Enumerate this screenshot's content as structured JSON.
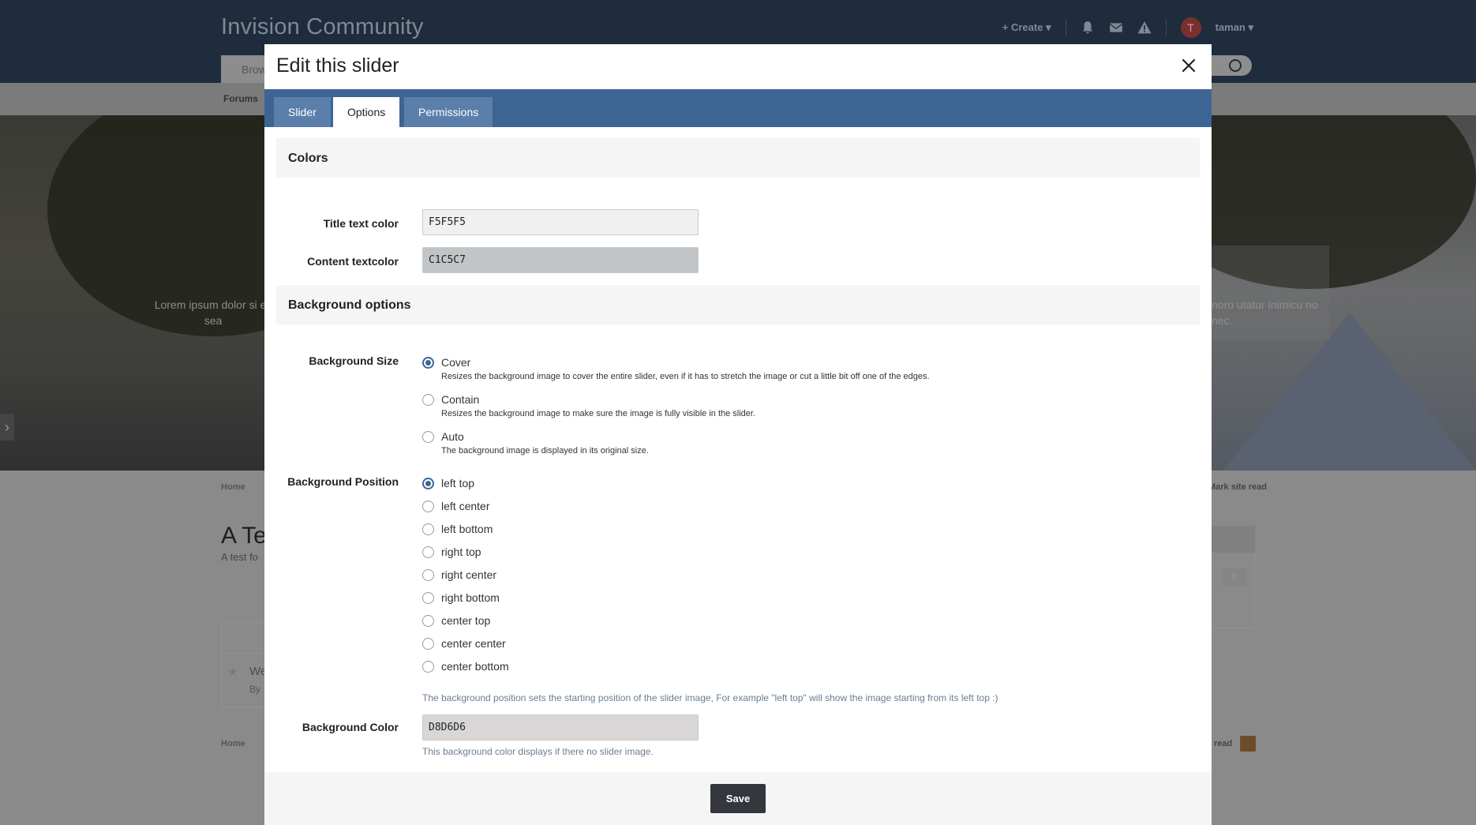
{
  "background": {
    "site_title": "Invision Community",
    "create_label": "+ Create ▾",
    "username": "taman ▾",
    "avatar_letter": "T",
    "nav_tab": "Brow",
    "subnav_item": "Forums",
    "hero_text_left": "Lorem ipsum dolor si ex sea",
    "hero_text_right": "noro utatur inimicu no nec.",
    "breadcrumb": "Home",
    "breadcrumb_right": "Mark site read",
    "forum_title": "A Te",
    "forum_desc": "A test fo",
    "right_count": "0",
    "topic_title": "We",
    "topic_by": "By",
    "breadcrumb_bottom": "Home",
    "breadcrumb_bottom_right": "read"
  },
  "modal": {
    "title": "Edit this slider",
    "tabs": [
      {
        "label": "Slider",
        "active": false
      },
      {
        "label": "Options",
        "active": true
      },
      {
        "label": "Permissions",
        "active": false
      }
    ],
    "colors_section": "Colors",
    "title_text_color": {
      "label": "Title text color",
      "value": "F5F5F5",
      "swatch": "#f0f0f0"
    },
    "content_text_color": {
      "label": "Content textcolor",
      "value": "C1C5C7",
      "swatch": "#c1c5c7"
    },
    "background_section": "Background options",
    "background_size": {
      "label": "Background Size",
      "options": [
        {
          "label": "Cover",
          "desc": "Resizes the background image to cover the entire slider, even if it has to stretch the image or cut a little bit off one of the edges.",
          "checked": true
        },
        {
          "label": "Contain",
          "desc": "Resizes the background image to make sure the image is fully visible in the slider.",
          "checked": false
        },
        {
          "label": "Auto",
          "desc": "The background image is displayed in its original size.",
          "checked": false
        }
      ]
    },
    "background_position": {
      "label": "Background Position",
      "options": [
        {
          "label": "left top",
          "checked": true
        },
        {
          "label": "left center",
          "checked": false
        },
        {
          "label": "left bottom",
          "checked": false
        },
        {
          "label": "right top",
          "checked": false
        },
        {
          "label": "right center",
          "checked": false
        },
        {
          "label": "right bottom",
          "checked": false
        },
        {
          "label": "center top",
          "checked": false
        },
        {
          "label": "center center",
          "checked": false
        },
        {
          "label": "center bottom",
          "checked": false
        }
      ],
      "hint": "The background position sets the starting position of the slider image, For example \"left top\" will show the image starting from its left top :)"
    },
    "background_color": {
      "label": "Background Color",
      "value": "D8D6D6",
      "swatch": "#d8d6d6",
      "hint": "This background color displays if there no slider image."
    },
    "save_label": "Save"
  },
  "colors": {
    "tabbar": "#3d6594",
    "header_bg": "#1e2c3d",
    "save_button": "#34373d"
  }
}
